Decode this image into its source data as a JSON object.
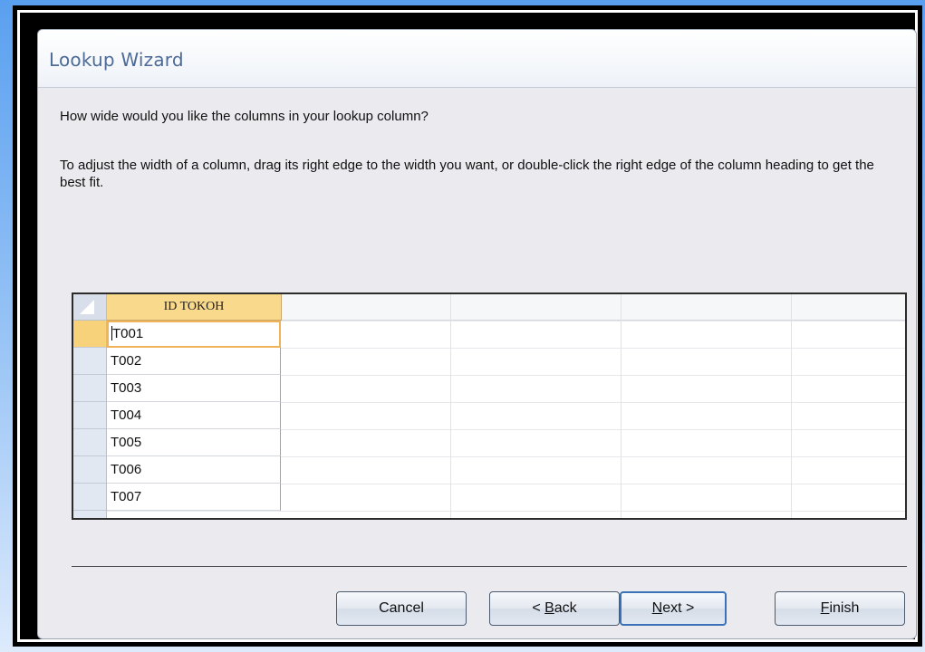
{
  "dialog": {
    "title": "Lookup Wizard",
    "question": "How wide would you like the columns in your lookup column?",
    "instructions": "To adjust the width of a column, drag its right edge to the width you want, or double-click the right edge of the column heading to get the best fit."
  },
  "grid": {
    "column_header": "ID TOKOH",
    "rows": [
      "T001",
      "T002",
      "T003",
      "T004",
      "T005",
      "T006",
      "T007"
    ],
    "current_row": 0
  },
  "buttons": {
    "cancel": "Cancel",
    "back": {
      "accel": "< ",
      "underline": "B",
      "rest": "ack"
    },
    "next": {
      "underline": "N",
      "rest": "ext >"
    },
    "finish": {
      "underline": "F",
      "rest": "inish"
    }
  },
  "colors": {
    "title_text": "#4d6b96",
    "header_highlight": "#f9d98c",
    "current_cell_border": "#f0b35a",
    "default_button_border": "#3a72b8"
  }
}
